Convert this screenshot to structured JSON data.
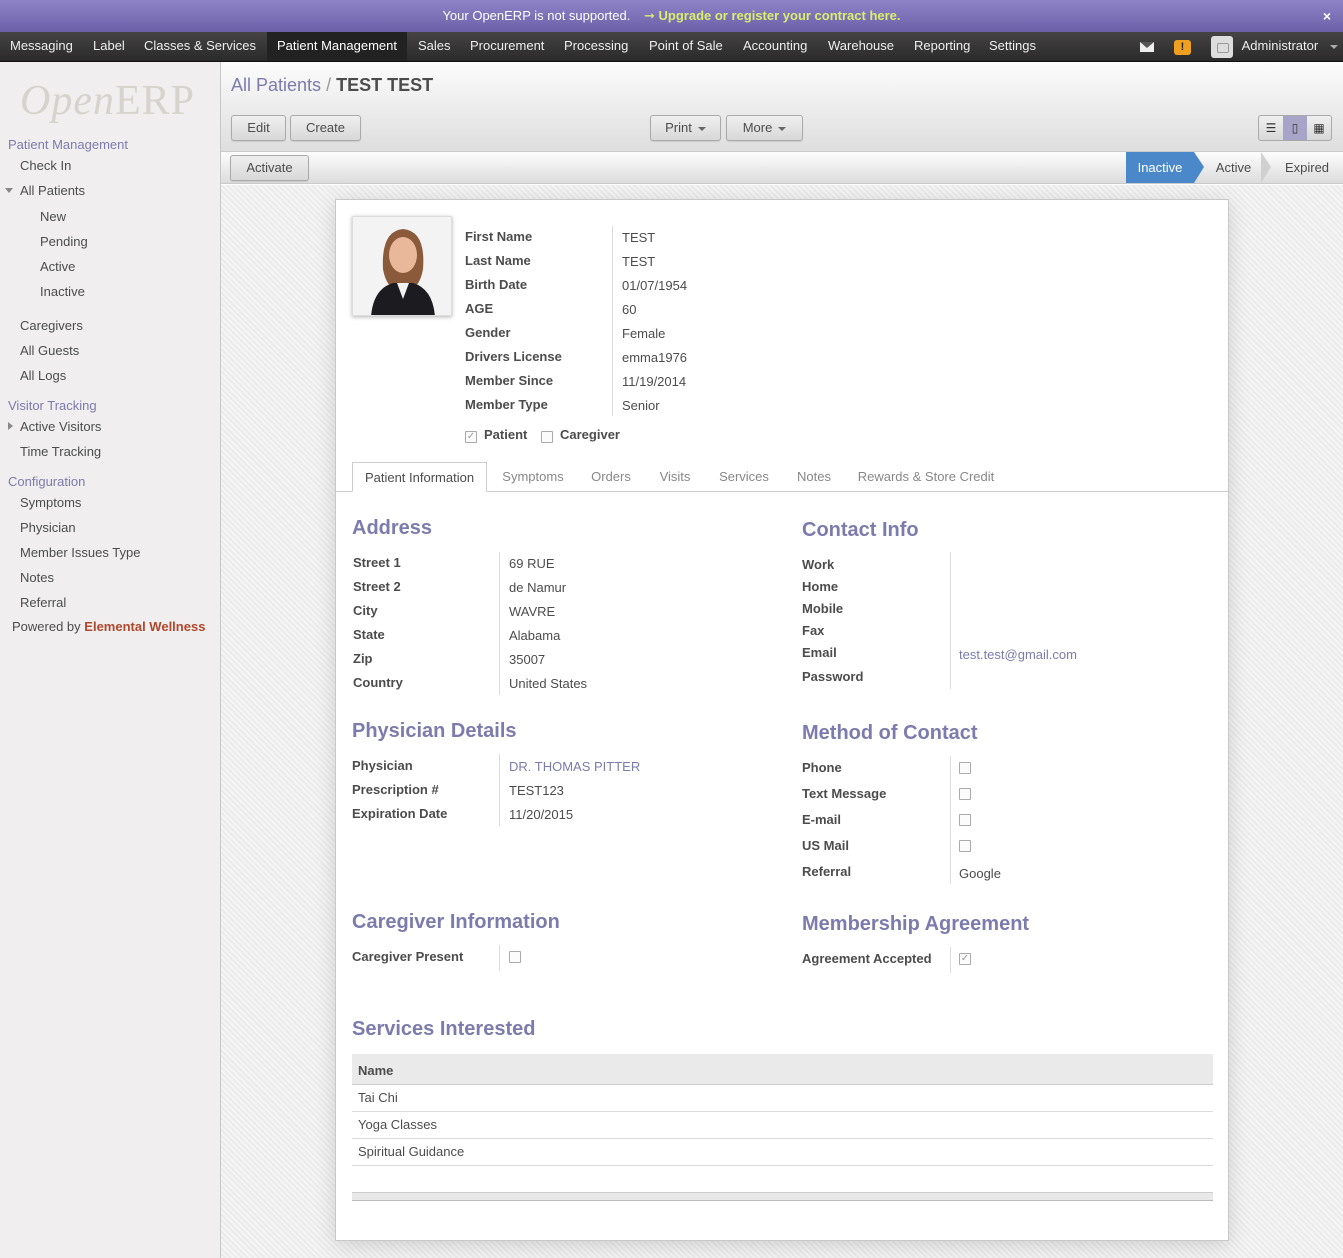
{
  "announcement": {
    "text": "Your OpenERP is not supported.",
    "link": "Upgrade or register your contract here.",
    "arrow": "➞",
    "close": "×"
  },
  "topmenu": {
    "items": [
      "Messaging",
      "Label",
      "Classes & Services",
      "Patient Management",
      "Sales",
      "Procurement",
      "Processing",
      "Point of Sale",
      "Accounting",
      "Warehouse",
      "Reporting",
      "Settings"
    ],
    "active": "Patient Management",
    "user": "Administrator",
    "warn_glyph": "!"
  },
  "logo": {
    "open": "Open",
    "erp": "ERP"
  },
  "sidebar": {
    "patient_management": "Patient Management",
    "check_in": "Check In",
    "all_patients": "All Patients",
    "new": "New",
    "pending": "Pending",
    "active": "Active",
    "inactive": "Inactive",
    "caregivers": "Caregivers",
    "all_guests": "All Guests",
    "all_logs": "All Logs",
    "visitor_tracking": "Visitor Tracking",
    "active_visitors": "Active Visitors",
    "time_tracking": "Time Tracking",
    "configuration": "Configuration",
    "symptoms": "Symptoms",
    "physician": "Physician",
    "member_issues_type": "Member Issues Type",
    "notes": "Notes",
    "referral": "Referral",
    "powered_by": "Powered by",
    "powered_brand": "Elemental Wellness"
  },
  "header": {
    "breadcrumb_parent": "All Patients",
    "breadcrumb_sep": "/",
    "breadcrumb_current": "TEST TEST",
    "edit": "Edit",
    "create": "Create",
    "print": "Print",
    "more": "More",
    "view_icons": [
      "☰",
      "▯",
      "▦"
    ]
  },
  "statusbar": {
    "activate": "Activate",
    "stages": [
      "Inactive",
      "Active",
      "Expired"
    ],
    "current_stage": "Inactive"
  },
  "patient": {
    "fields": [
      {
        "label": "First Name",
        "value": "TEST"
      },
      {
        "label": "Last Name",
        "value": "TEST"
      },
      {
        "label": "Birth Date",
        "value": "01/07/1954"
      },
      {
        "label": "AGE",
        "value": "60"
      },
      {
        "label": "Gender",
        "value": "Female"
      },
      {
        "label": "Drivers License",
        "value": "emma1976"
      },
      {
        "label": "Member Since",
        "value": "11/19/2014"
      },
      {
        "label": "Member Type",
        "value": "Senior"
      }
    ],
    "patient_label": "Patient",
    "patient_checked": true,
    "caregiver_label": "Caregiver",
    "caregiver_checked": false,
    "check_glyph": "✓"
  },
  "tabs": [
    "Patient Information",
    "Symptoms",
    "Orders",
    "Visits",
    "Services",
    "Notes",
    "Rewards & Store Credit"
  ],
  "active_tab": "Patient Information",
  "address": {
    "title": "Address",
    "fields": [
      {
        "label": "Street 1",
        "value": "69 RUE"
      },
      {
        "label": "Street 2",
        "value": "de Namur"
      },
      {
        "label": "City",
        "value": "WAVRE"
      },
      {
        "label": "State",
        "value": "Alabama"
      },
      {
        "label": "Zip",
        "value": "35007"
      },
      {
        "label": "Country",
        "value": "United States"
      }
    ]
  },
  "contact": {
    "title": "Contact Info",
    "fields": [
      {
        "label": "Work",
        "value": ""
      },
      {
        "label": "Home",
        "value": ""
      },
      {
        "label": "Mobile",
        "value": ""
      },
      {
        "label": "Fax",
        "value": ""
      },
      {
        "label": "Email",
        "value": "test.test@gmail.com"
      },
      {
        "label": "Password",
        "value": ""
      }
    ]
  },
  "physician": {
    "title": "Physician Details",
    "fields": [
      {
        "label": "Physician",
        "value": "DR. THOMAS PITTER"
      },
      {
        "label": "Prescription #",
        "value": "TEST123"
      },
      {
        "label": "Expiration Date",
        "value": "11/20/2015"
      }
    ]
  },
  "method": {
    "title": "Method of Contact",
    "phone": "Phone",
    "text_message": "Text Message",
    "email": "E-mail",
    "us_mail": "US Mail",
    "referral": "Referral",
    "referral_value": "Google"
  },
  "caregiver": {
    "title": "Caregiver Information",
    "present_label": "Caregiver Present",
    "present_checked": false
  },
  "membership": {
    "title": "Membership Agreement",
    "accepted_label": "Agreement Accepted",
    "accepted_checked": true
  },
  "services": {
    "title": "Services Interested",
    "column": "Name",
    "rows": [
      "Tai Chi",
      "Yoga Classes",
      "Spiritual Guidance"
    ]
  }
}
